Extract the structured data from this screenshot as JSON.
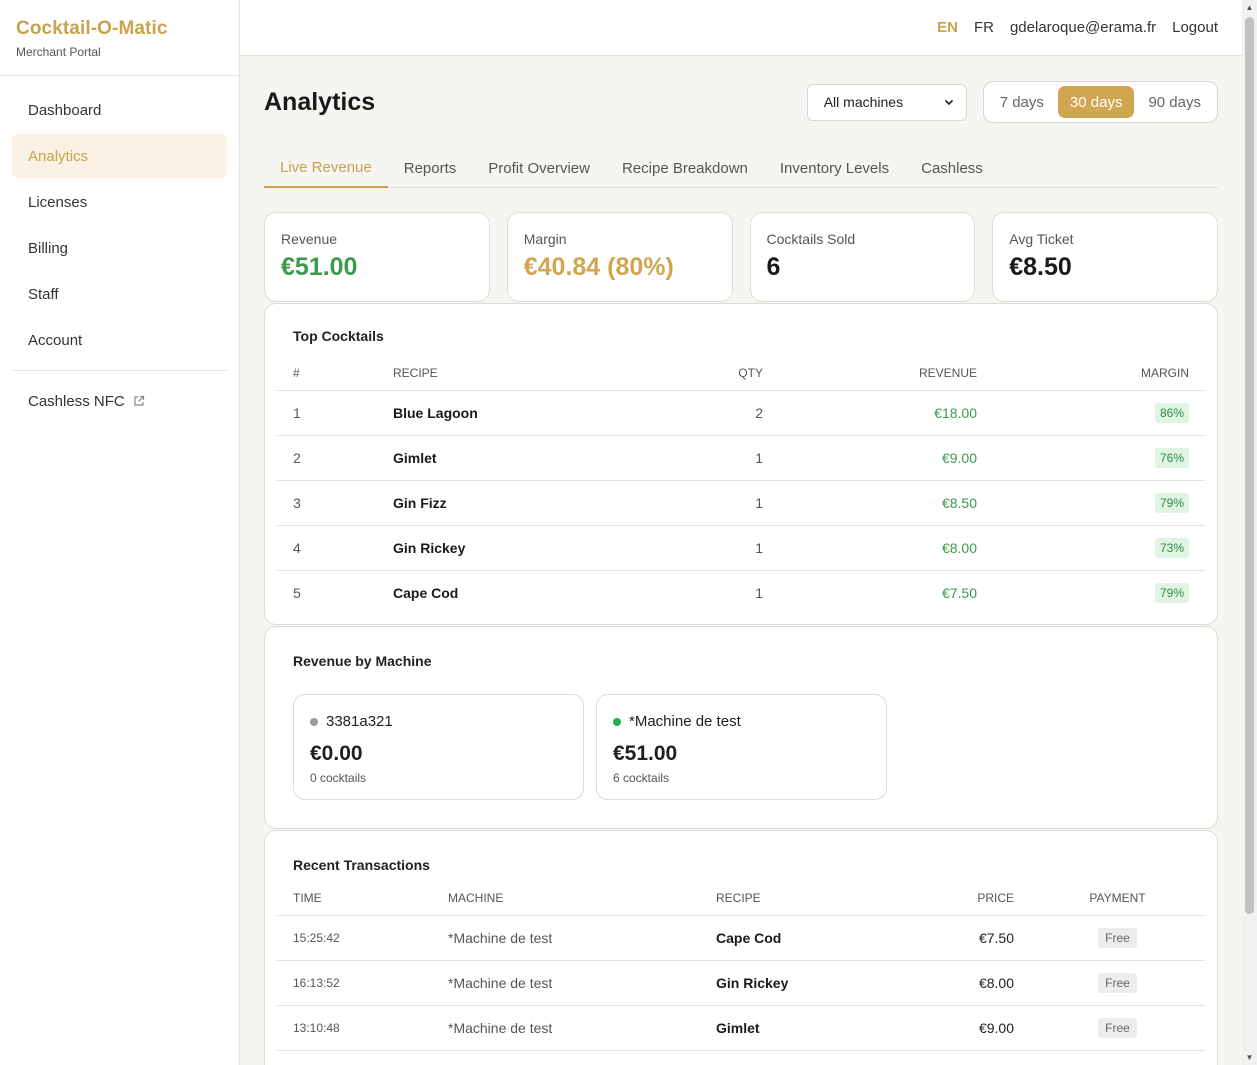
{
  "brand": {
    "title": "Cocktail-O-Matic",
    "subtitle": "Merchant Portal"
  },
  "sidebar": {
    "items": [
      {
        "label": "Dashboard"
      },
      {
        "label": "Analytics"
      },
      {
        "label": "Licenses"
      },
      {
        "label": "Billing"
      },
      {
        "label": "Staff"
      },
      {
        "label": "Account"
      }
    ],
    "external": {
      "label": "Cashless NFC",
      "icon": "external-link-icon"
    }
  },
  "topbar": {
    "lang_en": "EN",
    "lang_fr": "FR",
    "email": "gdelaroque@erama.fr",
    "logout": "Logout"
  },
  "page": {
    "title": "Analytics",
    "machine_select": "All machines",
    "ranges": [
      "7 days",
      "30 days",
      "90 days"
    ],
    "active_range": "30 days"
  },
  "tabs": [
    "Live Revenue",
    "Reports",
    "Profit Overview",
    "Recipe Breakdown",
    "Inventory Levels",
    "Cashless"
  ],
  "kpis": [
    {
      "label": "Revenue",
      "value": "€51.00",
      "color": "#3c9a4e"
    },
    {
      "label": "Margin",
      "value": "€40.84 (80%)",
      "color": "#d0a650"
    },
    {
      "label": "Cocktails Sold",
      "value": "6",
      "color": "#1a1a1a"
    },
    {
      "label": "Avg Ticket",
      "value": "€8.50",
      "color": "#1a1a1a"
    }
  ],
  "top_cocktails": {
    "title": "Top Cocktails",
    "headers": [
      "#",
      "RECIPE",
      "QTY",
      "REVENUE",
      "MARGIN"
    ],
    "rows": [
      {
        "rank": "1",
        "recipe": "Blue Lagoon",
        "qty": "2",
        "revenue": "€18.00",
        "margin": "86%"
      },
      {
        "rank": "2",
        "recipe": "Gimlet",
        "qty": "1",
        "revenue": "€9.00",
        "margin": "76%"
      },
      {
        "rank": "3",
        "recipe": "Gin Fizz",
        "qty": "1",
        "revenue": "€8.50",
        "margin": "79%"
      },
      {
        "rank": "4",
        "recipe": "Gin Rickey",
        "qty": "1",
        "revenue": "€8.00",
        "margin": "73%"
      },
      {
        "rank": "5",
        "recipe": "Cape Cod",
        "qty": "1",
        "revenue": "€7.50",
        "margin": "79%"
      }
    ]
  },
  "revenue_by_machine": {
    "title": "Revenue by Machine",
    "machines": [
      {
        "name": "3381a321",
        "amount": "€0.00",
        "count": "0 cocktails",
        "status_color": "#9a9a9a"
      },
      {
        "name": "*Machine de test",
        "amount": "€51.00",
        "count": "6 cocktails",
        "status_color": "#22b04b"
      }
    ]
  },
  "transactions": {
    "title": "Recent Transactions",
    "headers": [
      "TIME",
      "MACHINE",
      "RECIPE",
      "PRICE",
      "PAYMENT"
    ],
    "rows": [
      {
        "time": "15:25:42",
        "machine": "*Machine de test",
        "recipe": "Cape Cod",
        "price": "€7.50",
        "payment": "Free"
      },
      {
        "time": "16:13:52",
        "machine": "*Machine de test",
        "recipe": "Gin Rickey",
        "price": "€8.00",
        "payment": "Free"
      },
      {
        "time": "13:10:48",
        "machine": "*Machine de test",
        "recipe": "Gimlet",
        "price": "€9.00",
        "payment": "Free"
      }
    ]
  }
}
